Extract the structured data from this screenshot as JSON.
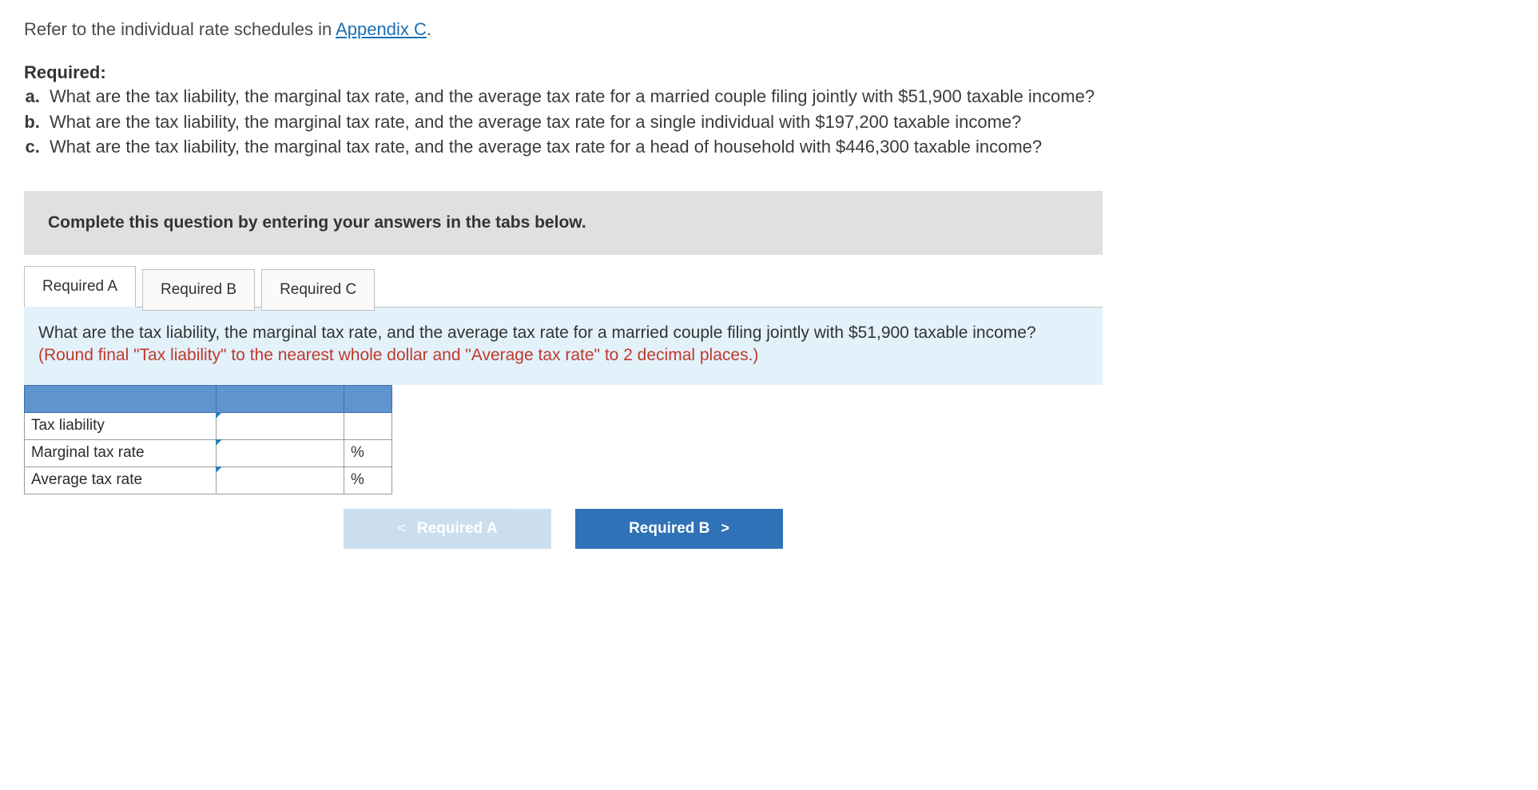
{
  "intro": {
    "prefix": "Refer to the individual rate schedules in ",
    "link_text": "Appendix C",
    "suffix": "."
  },
  "required_heading": "Required:",
  "questions": [
    "What are the tax liability, the marginal tax rate, and the average tax rate for a married couple filing jointly with $51,900 taxable income?",
    "What are the tax liability, the marginal tax rate, and the average tax rate for a single individual with $197,200 taxable income?",
    "What are the tax liability, the marginal tax rate, and the average tax rate for a head of household with $446,300 taxable income?"
  ],
  "instruction": "Complete this question by entering your answers in the tabs below.",
  "tabs": [
    {
      "label": "Required A"
    },
    {
      "label": "Required B"
    },
    {
      "label": "Required C"
    }
  ],
  "panel": {
    "question": "What are the tax liability, the marginal tax rate, and the average tax rate for a married couple filing jointly with $51,900 taxable income? ",
    "hint": "(Round final \"Tax liability\" to the nearest whole dollar and \"Average tax rate\" to 2 decimal places.)"
  },
  "table": {
    "rows": [
      {
        "label": "Tax liability",
        "unit": ""
      },
      {
        "label": "Marginal tax rate",
        "unit": "%"
      },
      {
        "label": "Average tax rate",
        "unit": "%"
      }
    ]
  },
  "nav": {
    "prev": "Required A",
    "next": "Required B"
  },
  "glyphs": {
    "left": "<",
    "right": ">"
  }
}
